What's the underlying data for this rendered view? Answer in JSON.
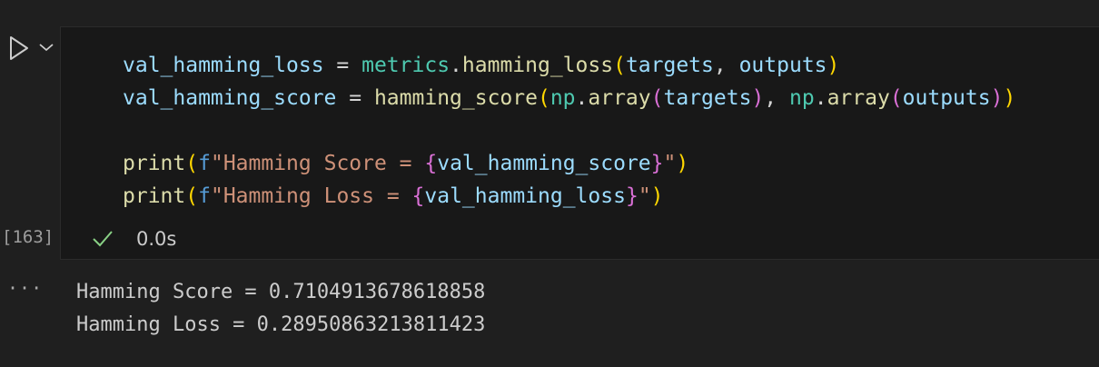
{
  "cell": {
    "execution_count": "[163]",
    "status_time": "0.0s",
    "code_lines": [
      [
        {
          "t": "val_hamming_loss",
          "c": "var"
        },
        {
          "t": " = ",
          "c": "op"
        },
        {
          "t": "metrics",
          "c": "mod"
        },
        {
          "t": ".",
          "c": "op"
        },
        {
          "t": "hamming_loss",
          "c": "fn"
        },
        {
          "t": "(",
          "c": "p1"
        },
        {
          "t": "targets",
          "c": "var"
        },
        {
          "t": ", ",
          "c": "op"
        },
        {
          "t": "outputs",
          "c": "var"
        },
        {
          "t": ")",
          "c": "p1"
        }
      ],
      [
        {
          "t": "val_hamming_score",
          "c": "var"
        },
        {
          "t": " = ",
          "c": "op"
        },
        {
          "t": "hamming_score",
          "c": "fn"
        },
        {
          "t": "(",
          "c": "p1"
        },
        {
          "t": "np",
          "c": "mod"
        },
        {
          "t": ".",
          "c": "op"
        },
        {
          "t": "array",
          "c": "fn"
        },
        {
          "t": "(",
          "c": "p2"
        },
        {
          "t": "targets",
          "c": "var"
        },
        {
          "t": ")",
          "c": "p2"
        },
        {
          "t": ", ",
          "c": "op"
        },
        {
          "t": "np",
          "c": "mod"
        },
        {
          "t": ".",
          "c": "op"
        },
        {
          "t": "array",
          "c": "fn"
        },
        {
          "t": "(",
          "c": "p2"
        },
        {
          "t": "outputs",
          "c": "var"
        },
        {
          "t": ")",
          "c": "p2"
        },
        {
          "t": ")",
          "c": "p1"
        }
      ],
      [],
      [
        {
          "t": "print",
          "c": "fn"
        },
        {
          "t": "(",
          "c": "p1"
        },
        {
          "t": "f",
          "c": "fpre"
        },
        {
          "t": "\"Hamming Score = ",
          "c": "str"
        },
        {
          "t": "{",
          "c": "p2"
        },
        {
          "t": "val_hamming_score",
          "c": "var"
        },
        {
          "t": "}",
          "c": "p2"
        },
        {
          "t": "\"",
          "c": "str"
        },
        {
          "t": ")",
          "c": "p1"
        }
      ],
      [
        {
          "t": "print",
          "c": "fn"
        },
        {
          "t": "(",
          "c": "p1"
        },
        {
          "t": "f",
          "c": "fpre"
        },
        {
          "t": "\"Hamming Loss = ",
          "c": "str"
        },
        {
          "t": "{",
          "c": "p2"
        },
        {
          "t": "val_hamming_loss",
          "c": "var"
        },
        {
          "t": "}",
          "c": "p2"
        },
        {
          "t": "\"",
          "c": "str"
        },
        {
          "t": ")",
          "c": "p1"
        }
      ]
    ]
  },
  "output": {
    "more_label": "···",
    "lines": [
      "Hamming Score = 0.7104913678618858",
      "Hamming Loss = 0.28950863213811423"
    ]
  },
  "icons": {
    "run": "play-icon",
    "run_menu": "chevron-down-icon",
    "status": "check-icon"
  },
  "colors": {
    "background": "#1f1f1f",
    "cell_background": "#181818",
    "success": "#89d185"
  }
}
